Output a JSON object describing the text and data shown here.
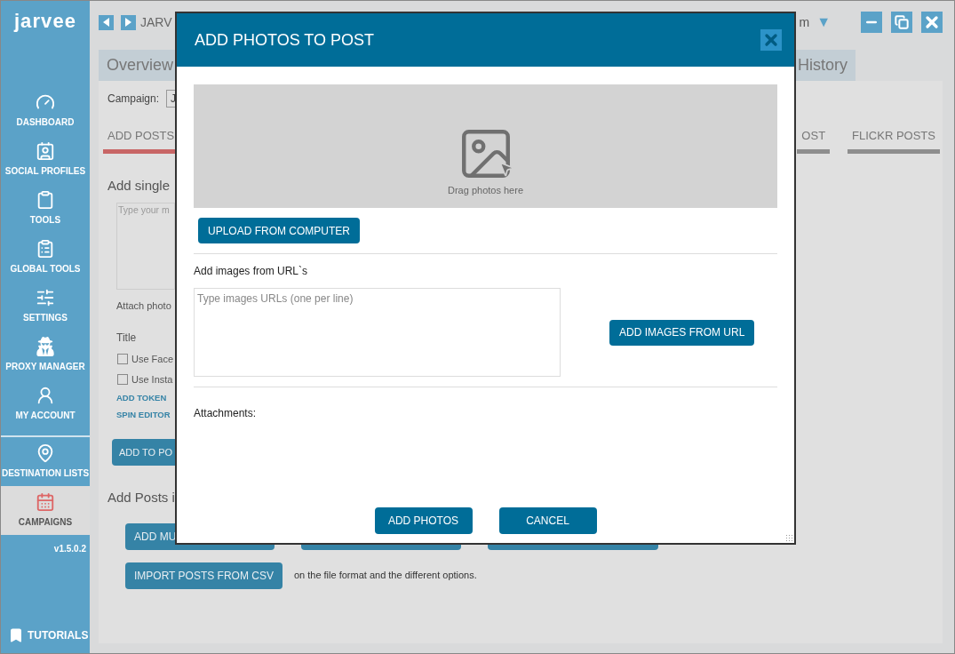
{
  "app": {
    "logo": "jarvee",
    "title": "JARV",
    "account": "m",
    "caret": "▼"
  },
  "sidebar": {
    "items": [
      {
        "label": "DASHBOARD",
        "selected": false
      },
      {
        "label": "SOCIAL PROFILES",
        "selected": false
      },
      {
        "label": "TOOLS",
        "selected": false
      },
      {
        "label": "GLOBAL TOOLS",
        "selected": false
      },
      {
        "label": "SETTINGS",
        "selected": false
      },
      {
        "label": "PROXY MANAGER",
        "selected": false
      },
      {
        "label": "MY ACCOUNT",
        "selected": false
      },
      {
        "label": "DESTINATION LISTS",
        "selected": false
      },
      {
        "label": "CAMPAIGNS",
        "selected": true
      }
    ],
    "version": "v1.5.0.2",
    "tutorials": "TUTORIALS"
  },
  "view_tabs": [
    "Overview",
    "History"
  ],
  "campaign": {
    "label": "Campaign:",
    "value": "J"
  },
  "post_tabs": [
    {
      "label": "ADD POSTS",
      "selected": true
    },
    {
      "label": "OST",
      "selected": false
    },
    {
      "label": "FLICKR POSTS",
      "selected": false
    }
  ],
  "single_post": {
    "heading": "Add single",
    "placeholder": "Type your m",
    "attach": "Attach photo",
    "title": "Title",
    "checkboxes": [
      {
        "label": "Use Face",
        "checked": false
      },
      {
        "label": "Use Insta",
        "checked": false
      }
    ],
    "links": [
      "ADD TOKEN",
      "SPIN EDITOR"
    ],
    "button": "ADD TO PO"
  },
  "bulk": {
    "heading": "Add Posts i",
    "button": "ADD MU",
    "import_button": "IMPORT POSTS FROM CSV",
    "note": "on the file format and the different options."
  },
  "dialog": {
    "title": "ADD PHOTOS TO POST",
    "drop_hint": "Drag photos here",
    "upload": "UPLOAD FROM COMPUTER",
    "url_label": "Add images from URL`s",
    "url_placeholder": "Type images URLs (one per line)",
    "add_url": "ADD IMAGES FROM URL",
    "attachments": "Attachments:",
    "buttons": [
      "ADD PHOTOS",
      "CANCEL"
    ]
  }
}
